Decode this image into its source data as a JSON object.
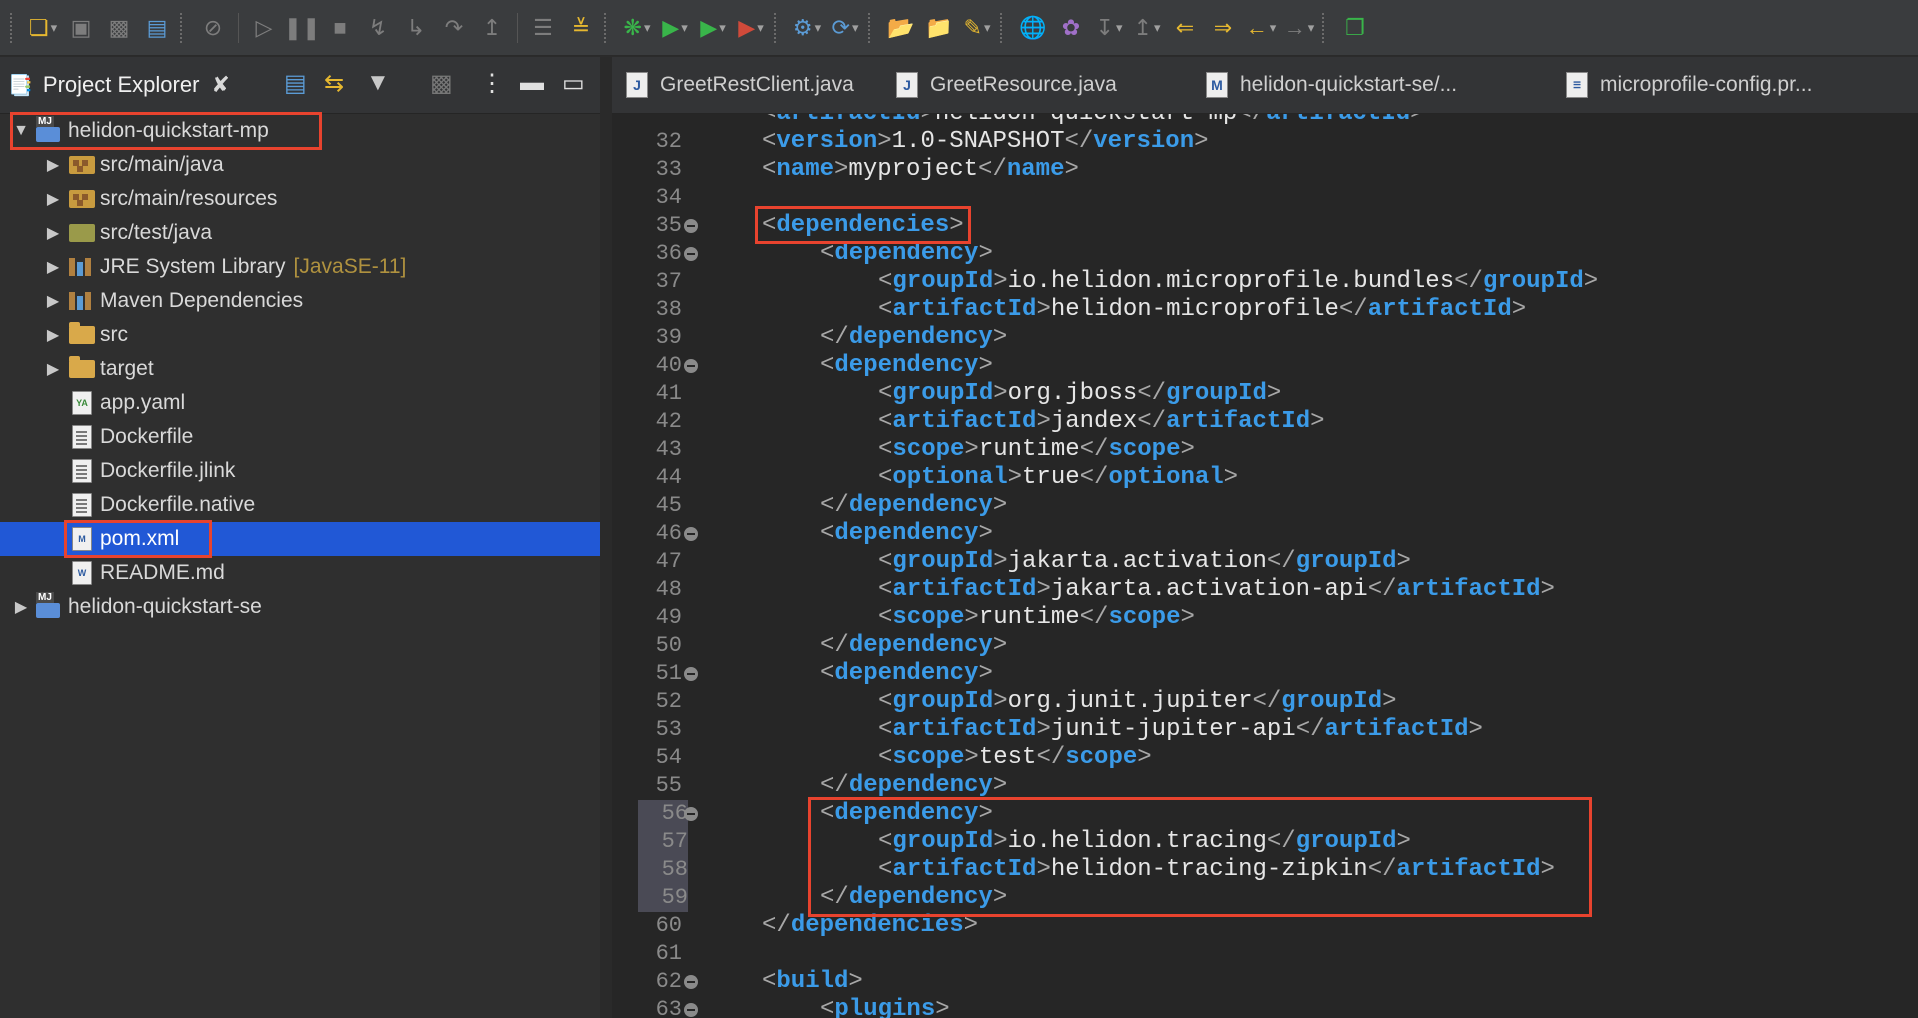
{
  "toolbar": {
    "icons": [
      "new-wizard-icon",
      "save-icon",
      "save-all-icon",
      "print-icon",
      "toggle-breakpoint-icon",
      "resume-icon",
      "suspend-icon",
      "terminate-icon",
      "disconnect-icon",
      "step-into-icon",
      "step-over-icon",
      "step-return-icon",
      "task-list-icon",
      "skip-breakpoints-icon",
      "debug-icon",
      "run-icon",
      "run-last-icon",
      "external-tools-icon",
      "new-server-icon",
      "new-service-icon",
      "open-type-icon",
      "open-task-icon",
      "pen-icon",
      "globe-icon",
      "search-icon",
      "annotation-icon",
      "annotation-2-icon",
      "prev-edit-icon",
      "next-edit-icon",
      "back-icon",
      "forward-icon",
      "perspective-icon"
    ]
  },
  "project_explorer": {
    "title": "Project Explorer",
    "tree": [
      {
        "label": "helidon-quickstart-mp",
        "expanded": true,
        "icon": "maven-project-icon"
      },
      {
        "label": "src/main/java",
        "icon": "package-folder-icon"
      },
      {
        "label": "src/main/resources",
        "icon": "package-folder-icon"
      },
      {
        "label": "src/test/java",
        "icon": "test-folder-icon"
      },
      {
        "label": "JRE System Library",
        "decoration": "[JavaSE-11]",
        "icon": "library-icon"
      },
      {
        "label": "Maven Dependencies",
        "icon": "library-icon"
      },
      {
        "label": "src",
        "icon": "folder-icon"
      },
      {
        "label": "target",
        "icon": "folder-icon"
      },
      {
        "label": "app.yaml",
        "icon": "yaml-file-icon"
      },
      {
        "label": "Dockerfile",
        "icon": "text-file-icon"
      },
      {
        "label": "Dockerfile.jlink",
        "icon": "text-file-icon"
      },
      {
        "label": "Dockerfile.native",
        "icon": "text-file-icon"
      },
      {
        "label": "pom.xml",
        "selected": true,
        "icon": "maven-file-icon"
      },
      {
        "label": "README.md",
        "icon": "word-file-icon"
      },
      {
        "label": "helidon-quickstart-se",
        "expanded": false,
        "icon": "maven-project-icon"
      }
    ]
  },
  "editor": {
    "tabs": [
      {
        "label": "GreetRestClient.java",
        "icon": "J"
      },
      {
        "label": "GreetResource.java",
        "icon": "J"
      },
      {
        "label": "helidon-quickstart-se/...",
        "icon": "M"
      },
      {
        "label": "microprofile-config.pr...",
        "icon": "prop"
      }
    ],
    "lines": [
      {
        "n": "32",
        "indent": 0,
        "tag": "version",
        "text": "1.0-SNAPSHOT",
        "type": "el"
      },
      {
        "n": "33",
        "indent": 0,
        "tag": "name",
        "text": "myproject",
        "type": "el"
      },
      {
        "n": "34",
        "type": "blank"
      },
      {
        "n": "35",
        "indent": 0,
        "tag": "dependencies",
        "type": "open",
        "fold": true
      },
      {
        "n": "36",
        "indent": 1,
        "tag": "dependency",
        "type": "open",
        "fold": true
      },
      {
        "n": "37",
        "indent": 2,
        "tag": "groupId",
        "text": "io.helidon.microprofile.bundles",
        "type": "el"
      },
      {
        "n": "38",
        "indent": 2,
        "tag": "artifactId",
        "text": "helidon-microprofile",
        "type": "el"
      },
      {
        "n": "39",
        "indent": 1,
        "tag": "dependency",
        "type": "close"
      },
      {
        "n": "40",
        "indent": 1,
        "tag": "dependency",
        "type": "open",
        "fold": true
      },
      {
        "n": "41",
        "indent": 2,
        "tag": "groupId",
        "text": "org.jboss",
        "type": "el"
      },
      {
        "n": "42",
        "indent": 2,
        "tag": "artifactId",
        "text": "jandex",
        "type": "el"
      },
      {
        "n": "43",
        "indent": 2,
        "tag": "scope",
        "text": "runtime",
        "type": "el"
      },
      {
        "n": "44",
        "indent": 2,
        "tag": "optional",
        "text": "true",
        "type": "el"
      },
      {
        "n": "45",
        "indent": 1,
        "tag": "dependency",
        "type": "close"
      },
      {
        "n": "46",
        "indent": 1,
        "tag": "dependency",
        "type": "open",
        "fold": true
      },
      {
        "n": "47",
        "indent": 2,
        "tag": "groupId",
        "text": "jakarta.activation",
        "type": "el"
      },
      {
        "n": "48",
        "indent": 2,
        "tag": "artifactId",
        "text": "jakarta.activation-api",
        "type": "el"
      },
      {
        "n": "49",
        "indent": 2,
        "tag": "scope",
        "text": "runtime",
        "type": "el"
      },
      {
        "n": "50",
        "indent": 1,
        "tag": "dependency",
        "type": "close"
      },
      {
        "n": "51",
        "indent": 1,
        "tag": "dependency",
        "type": "open",
        "fold": true
      },
      {
        "n": "52",
        "indent": 2,
        "tag": "groupId",
        "text": "org.junit.jupiter",
        "type": "el"
      },
      {
        "n": "53",
        "indent": 2,
        "tag": "artifactId",
        "text": "junit-jupiter-api",
        "type": "el"
      },
      {
        "n": "54",
        "indent": 2,
        "tag": "scope",
        "text": "test",
        "type": "el"
      },
      {
        "n": "55",
        "indent": 1,
        "tag": "dependency",
        "type": "close"
      },
      {
        "n": "56",
        "indent": 1,
        "tag": "dependency",
        "type": "open",
        "fold": true,
        "shade": true
      },
      {
        "n": "57",
        "indent": 2,
        "tag": "groupId",
        "text": "io.helidon.tracing",
        "type": "el",
        "shade": true
      },
      {
        "n": "58",
        "indent": 2,
        "tag": "artifactId",
        "text": "helidon-tracing-zipkin",
        "type": "el",
        "shade": true
      },
      {
        "n": "59",
        "indent": 1,
        "tag": "dependency",
        "type": "close",
        "shade": true
      },
      {
        "n": "60",
        "indent": 0,
        "tag": "dependencies",
        "type": "close"
      },
      {
        "n": "61",
        "type": "blank"
      },
      {
        "n": "62",
        "indent": 0,
        "tag": "build",
        "type": "open",
        "fold": true
      },
      {
        "n": "63",
        "indent": 1,
        "tag": "plugins",
        "type": "open",
        "fold": true
      }
    ]
  }
}
